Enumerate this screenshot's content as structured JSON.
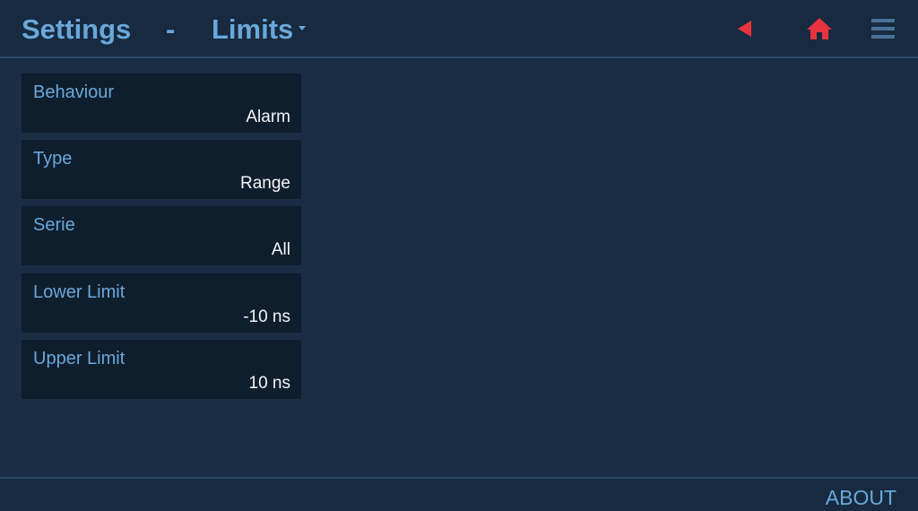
{
  "header": {
    "title": "Settings",
    "separator": "-",
    "page": "Limits",
    "icons": {
      "back": "back-triangle-icon",
      "home": "home-icon",
      "menu": "hamburger-menu-icon"
    }
  },
  "settings": [
    {
      "label": "Behaviour",
      "value": "Alarm"
    },
    {
      "label": "Type",
      "value": "Range"
    },
    {
      "label": "Serie",
      "value": "All"
    },
    {
      "label": "Lower Limit",
      "value": "-10 ns"
    },
    {
      "label": "Upper Limit",
      "value": "10 ns"
    }
  ],
  "footer": {
    "about": "ABOUT"
  },
  "colors": {
    "accent": "#6aa8db",
    "alert": "#e8333f",
    "background": "#1b2d44",
    "panel": "#0f1e2d",
    "value_text": "#f2f5f8",
    "menu_icon": "#4a7196"
  }
}
